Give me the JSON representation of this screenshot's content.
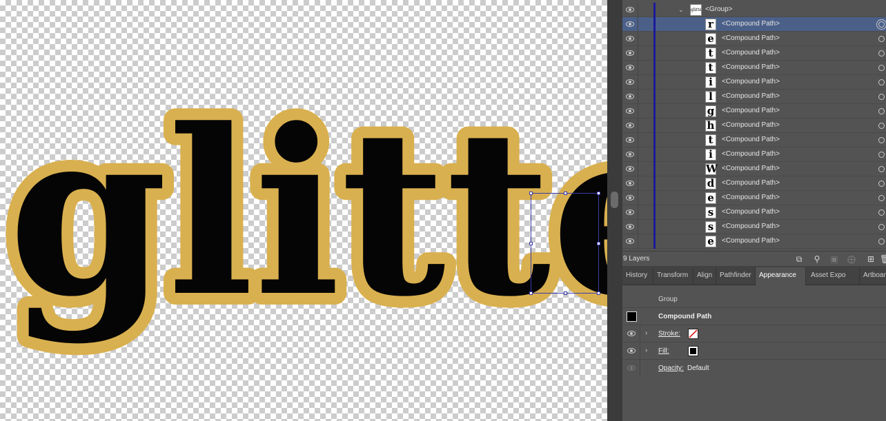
{
  "canvas": {
    "artwork_text": "glitter",
    "outline_color": "#d9b04f",
    "fill_color": "#050505"
  },
  "layers": {
    "group_label": "<Group>",
    "rows": [
      {
        "letter": "r",
        "label": "<Compound Path>",
        "selected": true
      },
      {
        "letter": "e",
        "label": "<Compound Path>"
      },
      {
        "letter": "t",
        "label": "<Compound Path>"
      },
      {
        "letter": "t",
        "label": "<Compound Path>"
      },
      {
        "letter": "i",
        "label": "<Compound Path>"
      },
      {
        "letter": "l",
        "label": "<Compound Path>"
      },
      {
        "letter": "g",
        "label": "<Compound Path>"
      },
      {
        "letter": "h",
        "label": "<Compound Path>"
      },
      {
        "letter": "t",
        "label": "<Compound Path>"
      },
      {
        "letter": "i",
        "label": "<Compound Path>"
      },
      {
        "letter": "W",
        "label": "<Compound Path>"
      },
      {
        "letter": "d",
        "label": "<Compound Path>"
      },
      {
        "letter": "e",
        "label": "<Compound Path>"
      },
      {
        "letter": "s",
        "label": "<Compound Path>"
      },
      {
        "letter": "s",
        "label": "<Compound Path>"
      },
      {
        "letter": "e",
        "label": "<Compound Path>"
      }
    ],
    "count_label": "9 Layers",
    "layer_color": "#1a1a9a",
    "selected_color": "#4b6089"
  },
  "tabs": [
    {
      "label": "History"
    },
    {
      "label": "Transform"
    },
    {
      "label": "Align"
    },
    {
      "label": "Pathfinder"
    },
    {
      "label": "Appearance",
      "active": true
    },
    {
      "label": "Asset Expo"
    },
    {
      "label": "Artboards"
    }
  ],
  "appearance": {
    "group_label": "Group",
    "object_label": "Compound Path",
    "stroke_label": "Stroke:",
    "fill_label": "Fill:",
    "opacity_label": "Opacity:",
    "opacity_value": "Default",
    "stroke_value": "none",
    "fill_value": "#000000"
  },
  "icons": {
    "eye": "eye-icon",
    "target": "target-circle-icon",
    "footer": [
      "collect-export-icon",
      "search-icon",
      "clipping-mask-icon",
      "new-sublayer-icon",
      "new-layer-icon",
      "trash-icon"
    ]
  }
}
